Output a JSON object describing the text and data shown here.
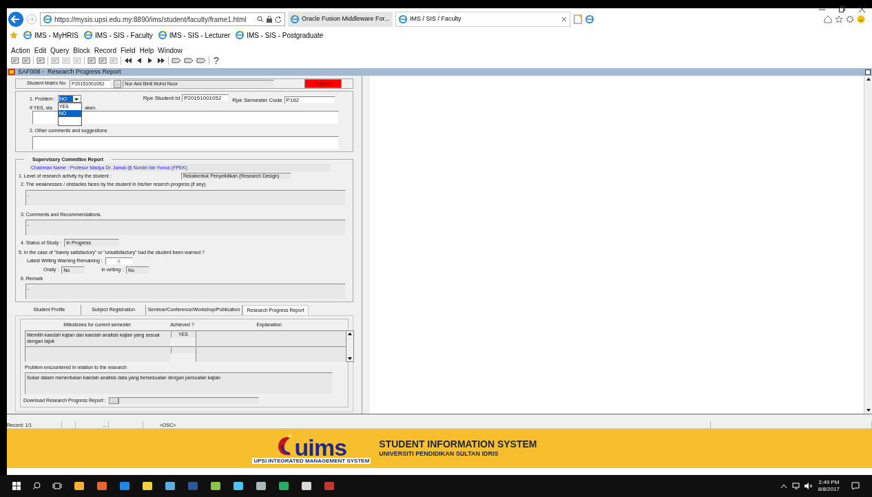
{
  "browser": {
    "address": "https://mysis.upsi.edu.my:8890/ims/student/faculty/frame1.html",
    "tabs": [
      {
        "label": "Oracle Fusion Middleware For...",
        "selected": false
      },
      {
        "label": "IMS / SIS / Faculty",
        "selected": true
      }
    ],
    "favorites": [
      "IMS - MyHRIS",
      "IMS - SIS - Faculty",
      "IMS - SIS - Lecturer",
      "IMS - SIS - Postgraduate"
    ]
  },
  "menu": [
    "Action",
    "Edit",
    "Query",
    "Block",
    "Record",
    "Field",
    "Help",
    "Window"
  ],
  "help_button": "?",
  "form_title": "SAF008 -  Research Progress Report",
  "student": {
    "label": "Student Matrix No",
    "matrix_no": "P20151001052",
    "lookup": "...",
    "name": "Nor Aini Binti Mohd Noor",
    "submit": "SUBMIT"
  },
  "problem": {
    "label": "1. Problem :",
    "value": "NO",
    "options": [
      {
        "label": "YES",
        "selected": false
      },
      {
        "label": "NO",
        "selected": true
      }
    ],
    "hint_start": "If YES, sta",
    "hint_end": "aken.",
    "student_id_label": "Rpe Student Id",
    "student_id": "P20151001052",
    "semester_label": "Rpe Semester Code",
    "semester": "P162",
    "comments_label": "2. Other comments and suggestions"
  },
  "committee": {
    "title": "Supervisory Committee Report",
    "chairman": "Chairman Name : Profesor Madya Dr. Jamal @ Nordin bin Yunus  (FPEK)",
    "level_label": "1. Level of research activity by the student :",
    "level_value": "Rekabentuk Penyelidikan (Research Design)",
    "weakness_label": "2. The weaknesses / obstacles faces by the student in his/her reserch progress (if any).",
    "weakness_value": "-",
    "comments_label": "3. Comments and Recommendations.",
    "comments_value": "-",
    "status_label": "4. Status of Study :",
    "status_value": "In Progress",
    "warned_label": "5. In the case of \"barely satisfactory\" or \"unsatisfactory\" had the student been warned ?",
    "warning_label": "Latest Writing Warning Remaining :",
    "warning_value": "0",
    "orally_label": "Orally :",
    "orally_value": "No",
    "writing_label": "In writing :",
    "writing_value": "No",
    "remark_label": "6. Remark",
    "remark_value": "-"
  },
  "tabs": [
    {
      "label": "Student Profile",
      "selected": false
    },
    {
      "label": "Subject Registration",
      "selected": false
    },
    {
      "label": "Seminar/Conference/Workshop/Publication",
      "selected": false
    },
    {
      "label": "Research Progress Report",
      "selected": true
    }
  ],
  "milestones": {
    "columns": [
      "Milestones for current semester",
      "Achieved ?",
      "Explanation"
    ],
    "rows": [
      {
        "milestone": "Memilih kaedah kajian dan kaedah analisis kajian yang sesuai dengan tajuk",
        "achieved": "YES"
      },
      {
        "milestone": "",
        "achieved": ""
      }
    ],
    "problem_label": "Problem encountered in relation to the research",
    "problem_value": "Sukar dalam menentukan kaedah analisis data yang bersesuaian dengan persoalan kajian",
    "download_label": "Download Research Progress Report :",
    "download_button": "..."
  },
  "status_bar": {
    "record": "Record: 1/1",
    "cell_2": "...",
    "mode": "<OSC>"
  },
  "banner": {
    "logo": "uims",
    "logo_caption": "UPSI INTEGRATED MANAGEMENT SYSTEM",
    "title": "STUDENT INFORMATION SYSTEM",
    "subtitle": "UNIVERSITI PENDIDIKAN SULTAN IDRIS"
  },
  "taskbar": {
    "time": "2:49 PM",
    "date": "8/8/2017"
  }
}
